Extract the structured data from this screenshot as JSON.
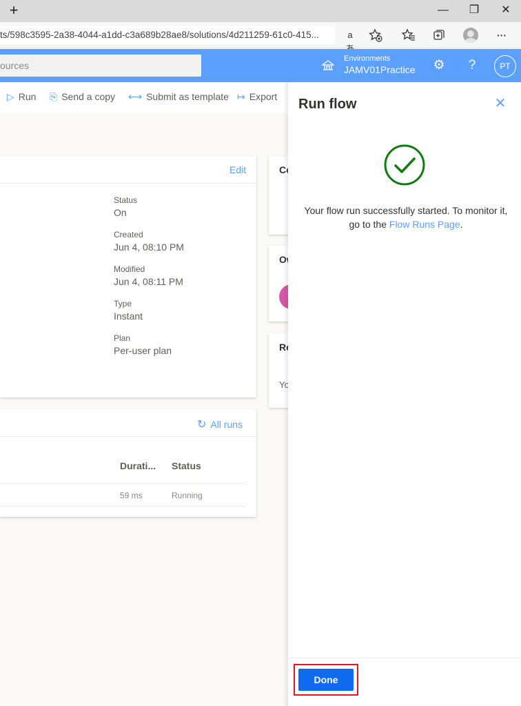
{
  "browser": {
    "newtab_glyph": "+",
    "minimize_glyph": "—",
    "restore_glyph": "❐",
    "close_glyph": "✕",
    "url": "ts/598c3595-2a38-4044-a1dd-c3a689b28ae8/solutions/4d211259-61c0-415...",
    "read_aloud_glyph": "aあ",
    "more_glyph": "···"
  },
  "header": {
    "search_placeholder": "ources",
    "env_label": "Environments",
    "env_name": "JAMV01Practice",
    "settings_glyph": "⚙",
    "help_glyph": "?",
    "avatar_initials": "PT"
  },
  "commands": [
    {
      "icon": "▷",
      "label": "Run"
    },
    {
      "icon": "⎘",
      "label": "Send a copy"
    },
    {
      "icon": "⟷",
      "label": "Submit as template"
    },
    {
      "icon": "↦",
      "label": "Export"
    }
  ],
  "details": {
    "edit_label": "Edit",
    "props": [
      {
        "label": "Status",
        "value": "On"
      },
      {
        "label": "Created",
        "value": "Jun 4, 08:10 PM"
      },
      {
        "label": "Modified",
        "value": "Jun 4, 08:11 PM"
      },
      {
        "label": "Type",
        "value": "Instant"
      },
      {
        "label": "Plan",
        "value": "Per-user plan"
      }
    ]
  },
  "runs": {
    "all_runs_label": "All runs",
    "columns": [
      "Durati...",
      "Status"
    ],
    "rows": [
      {
        "duration": "59 ms",
        "status": "Running"
      }
    ]
  },
  "side_cards": {
    "card1": "Co",
    "card2": "Ow",
    "card3": "Re",
    "card3_text": "Yo"
  },
  "panel": {
    "title": "Run flow",
    "close_glyph": "✕",
    "message_before": "Your flow run successfully started. To monitor it, go to the ",
    "link": "Flow Runs Page",
    "message_after": ".",
    "done_label": "Done"
  },
  "colors": {
    "accent": "#5ca0ff",
    "primary_button": "#0f6cf0",
    "success": "#107c10",
    "highlight": "#e81123"
  }
}
